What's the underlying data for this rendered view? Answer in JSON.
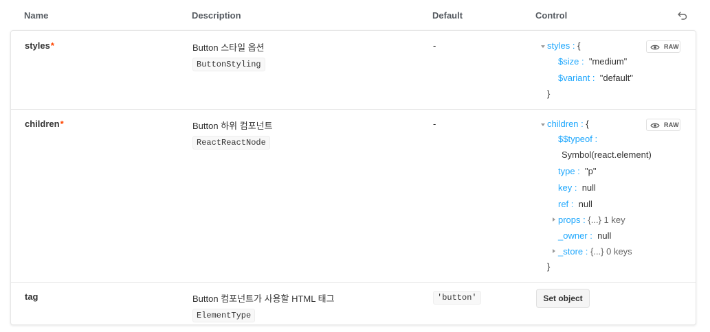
{
  "header": {
    "name": "Name",
    "description": "Description",
    "default": "Default",
    "control": "Control"
  },
  "rows": [
    {
      "name": "styles",
      "required_mark": "*",
      "description": "Button 스타일 옵션",
      "type": "ButtonStyling",
      "default": "-",
      "raw_label": "RAW",
      "json": {
        "root_key": "styles :",
        "root_open": "{",
        "entries": [
          {
            "key": "$size :",
            "value": "\"medium\""
          },
          {
            "key": "$variant :",
            "value": "\"default\""
          }
        ],
        "close": "}"
      }
    },
    {
      "name": "children",
      "required_mark": "*",
      "description": "Button 하위 컴포넌트",
      "type": "ReactReactNode",
      "default": "-",
      "raw_label": "RAW",
      "json": {
        "root_key": "children :",
        "root_open": "{",
        "typeof_key": "$$typeof :",
        "typeof_value": "Symbol(react.element)",
        "entries": [
          {
            "key": "type :",
            "value": "\"p\""
          },
          {
            "key": "key :",
            "value": "null"
          },
          {
            "key": "ref :",
            "value": "null"
          },
          {
            "key": "props :",
            "value": "{...} 1 key"
          },
          {
            "key": "_owner :",
            "value": "null"
          },
          {
            "key": "_store :",
            "value": "{...} 0 keys"
          }
        ],
        "close": "}"
      }
    },
    {
      "name": "tag",
      "required_mark": "",
      "description": "Button 컴포넌트가 사용할 HTML 태그",
      "type": "ElementType",
      "default": "'button'",
      "control_button": "Set object"
    }
  ],
  "colors": {
    "json_key": "#1ea7fd",
    "required": "#ff4400",
    "border": "#e6e6e6"
  },
  "icons": {
    "reset": "undo-icon",
    "raw": "eye-icon",
    "collapse": "caret-down-icon",
    "expand": "caret-right-icon"
  }
}
